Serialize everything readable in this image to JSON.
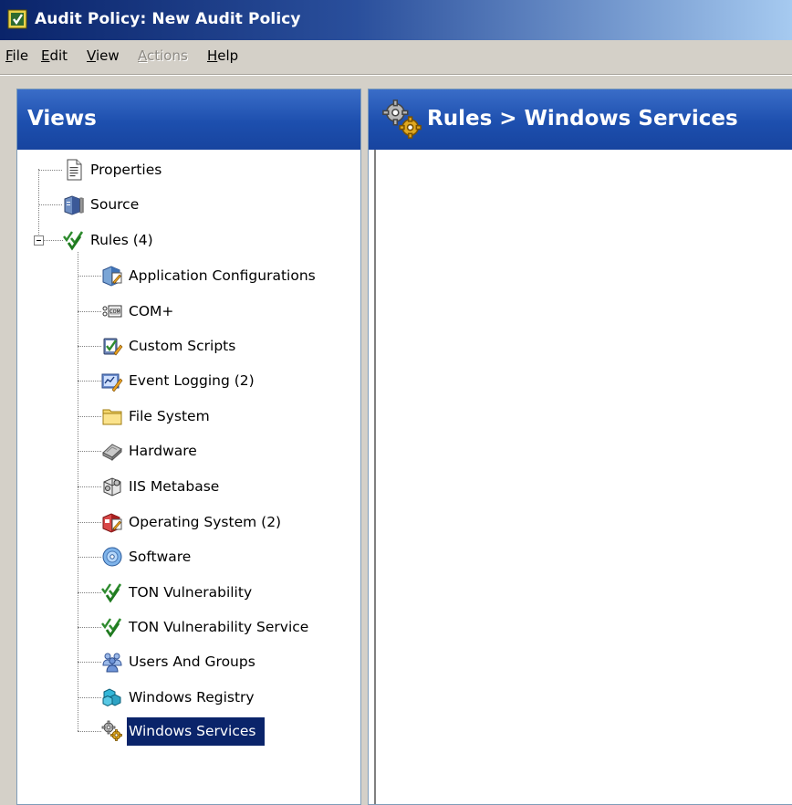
{
  "window": {
    "title": "Audit Policy: New Audit Policy"
  },
  "menu": {
    "items": [
      {
        "mnemonic": "F",
        "rest": "ile",
        "enabled": true
      },
      {
        "mnemonic": "E",
        "rest": "dit",
        "enabled": true
      },
      {
        "mnemonic": "V",
        "rest": "iew",
        "enabled": true
      },
      {
        "mnemonic": "A",
        "rest": "ctions",
        "enabled": false
      },
      {
        "mnemonic": "H",
        "rest": "elp",
        "enabled": true
      }
    ]
  },
  "views_panel": {
    "title": "Views",
    "tree": {
      "properties": {
        "label": "Properties",
        "icon": "document-icon"
      },
      "source": {
        "label": "Source",
        "icon": "server-icon"
      },
      "rules": {
        "label": "Rules (4)",
        "icon": "checkmarks-icon",
        "expanded": true,
        "children": [
          {
            "label": "Application Configurations",
            "icon": "app-config-icon"
          },
          {
            "label": "COM+",
            "icon": "com-icon"
          },
          {
            "label": "Custom Scripts",
            "icon": "custom-scripts-icon"
          },
          {
            "label": "Event Logging (2)",
            "icon": "event-logging-icon"
          },
          {
            "label": "File System",
            "icon": "folder-icon"
          },
          {
            "label": "Hardware",
            "icon": "hardware-icon"
          },
          {
            "label": "IIS Metabase",
            "icon": "iis-metabase-icon"
          },
          {
            "label": "Operating System (2)",
            "icon": "operating-system-icon"
          },
          {
            "label": "Software",
            "icon": "software-icon"
          },
          {
            "label": "TON Vulnerability",
            "icon": "checkmarks-icon"
          },
          {
            "label": "TON Vulnerability Service",
            "icon": "checkmarks-icon"
          },
          {
            "label": "Users And Groups",
            "icon": "users-icon"
          },
          {
            "label": "Windows Registry",
            "icon": "registry-icon"
          },
          {
            "label": "Windows Services",
            "icon": "gears-icon",
            "selected": true
          }
        ]
      }
    }
  },
  "content_panel": {
    "title": "Rules > Windows Services",
    "icon": "gears-icon"
  },
  "colors": {
    "header_blue": "#1d4fae",
    "selection": "#0a246a",
    "chrome": "#d4d0c8"
  }
}
